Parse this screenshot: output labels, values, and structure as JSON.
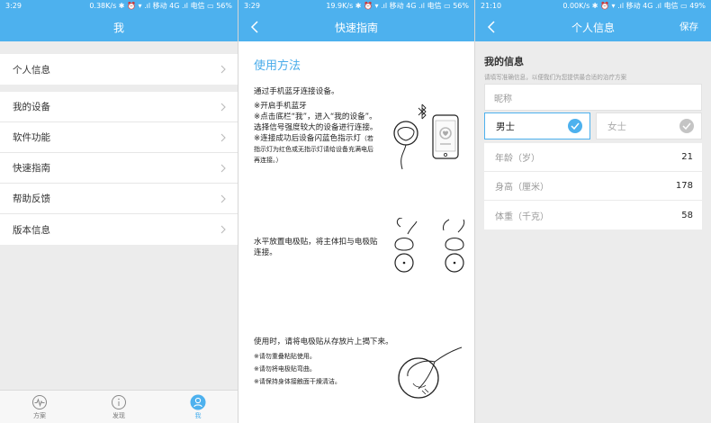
{
  "screen1": {
    "status": {
      "time": "3:29",
      "speed": "0.38K/s",
      "carrier1": "移动 4G",
      "carrier2": "电信",
      "battery": "56%"
    },
    "title": "我",
    "groups": [
      [
        {
          "label": "个人信息"
        }
      ],
      [
        {
          "label": "我的设备"
        },
        {
          "label": "软件功能"
        },
        {
          "label": "快速指南"
        },
        {
          "label": "帮助反馈"
        },
        {
          "label": "版本信息"
        }
      ]
    ],
    "tabs": [
      {
        "label": "方案",
        "icon": "heartbeat-icon"
      },
      {
        "label": "发现",
        "icon": "info-icon"
      },
      {
        "label": "我",
        "icon": "user-icon"
      }
    ]
  },
  "screen2": {
    "status": {
      "time": "3:29",
      "speed": "19.9K/s",
      "carrier1": "移动 4G",
      "carrier2": "电信",
      "battery": "56%"
    },
    "title": "快速指南",
    "guide_title": "使用方法",
    "step1": {
      "heading": "通过手机蓝牙连接设备。",
      "lines": [
        "※开启手机蓝牙",
        "※点击底栏“我”，进入“我的设备”。",
        "选择信号强度较大的设备进行连接。",
        "※连接成功后设备闪蓝色指示灯"
      ],
      "small": [
        "（若",
        "指示灯为红色或无指示灯请给设备充满电后",
        "再连接。）"
      ]
    },
    "step2": {
      "lines": [
        "水平放置电极贴，将主体扣与电极贴",
        "连接。"
      ]
    },
    "step3": {
      "heading": "使用时，请将电极贴从存放片上揭下来。",
      "small": [
        "※请勿重叠粘贴使用。",
        "※请勿将电极贴弯曲。",
        "※请保持身体接触面干燥清洁。"
      ]
    }
  },
  "screen3": {
    "status": {
      "time": "21:10",
      "speed": "0.00K/s",
      "carrier1": "移动 4G",
      "carrier2": "电信",
      "battery": "49%"
    },
    "title": "个人信息",
    "save_label": "保存",
    "section_title": "我的信息",
    "hint": "请填写准确信息，以便我们为您提供最合适的治疗方案",
    "nickname_placeholder": "昵称",
    "gender": {
      "male": "男士",
      "female": "女士",
      "selected": "male"
    },
    "metrics": [
      {
        "label": "年龄（岁）",
        "value": "21"
      },
      {
        "label": "身高（厘米）",
        "value": "178"
      },
      {
        "label": "体重（千克）",
        "value": "58"
      }
    ],
    "colors": {
      "accent": "#4db1ee"
    }
  }
}
